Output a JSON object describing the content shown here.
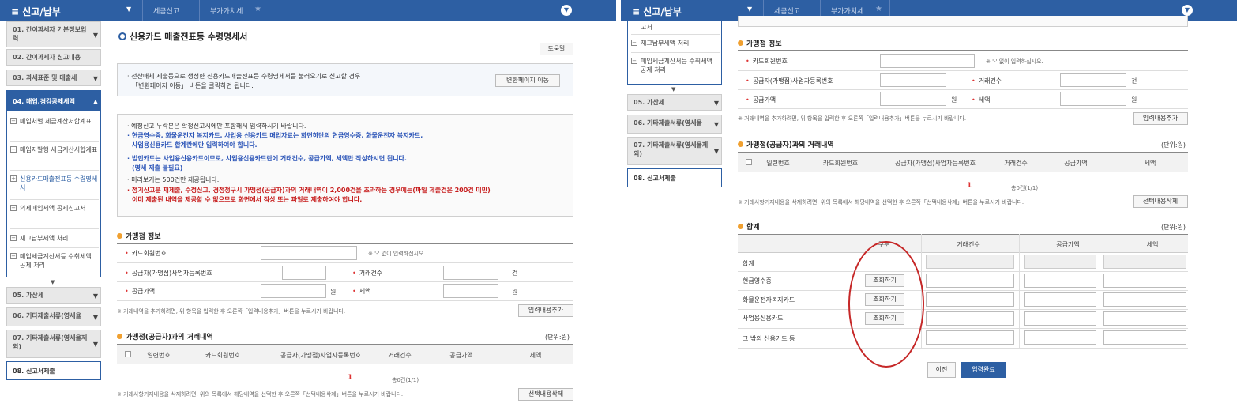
{
  "header": {
    "title": "신고/납부",
    "crumb1": "세금신고",
    "crumb2": "부가가치세"
  },
  "sidebar": {
    "steps": [
      {
        "label": "01. 간이과세자 기본정보입력"
      },
      {
        "label": "02. 간이과세자 신고내용"
      },
      {
        "label": "03. 과세표준 및 매출세"
      },
      {
        "label": "04. 매입,경감공제세액"
      },
      {
        "label": "05. 가산세"
      },
      {
        "label": "06. 기타제출서류(영세율"
      },
      {
        "label": "07. 기타제출서류(영세율제외)"
      },
      {
        "label": "08. 신고서제출"
      }
    ],
    "subitems": [
      {
        "label": "매입처별 세금계산서합계표"
      },
      {
        "label": "매입자발행 세금계산서합계표"
      },
      {
        "label": "신용카드매출전표등 수령명세서"
      },
      {
        "label": "의제매입세액 공제신고서"
      },
      {
        "label": "재고납부세액 처리"
      },
      {
        "label": "매입세금계산서등 수취세액 공제 처리"
      }
    ],
    "right_partial_tail": "고서"
  },
  "page": {
    "title": "신용카드 매출전표등 수령명세서",
    "help_button": "도움말",
    "convert_text_1": "전산매체 제출등으로 생성한 신용카드매출전표등 수령명세서를 불러오기로 신고할 경우",
    "convert_text_2": "「변환페이지 이동」 버튼을 클릭하면 됩니다.",
    "convert_button": "변환페이지 이동",
    "notices": [
      {
        "text": "예정신고 누락분은 확정신고시에만 포함해서 입력하시기 바랍니다.",
        "style": "normal"
      },
      {
        "text": "현금영수증, 화물운전자 복지카드, 사업용 신용카드 매입자료는 화면하단의 현금영수증, 화물운전자 복지카드,",
        "style": "blue"
      },
      {
        "text": "사업용신용카드 합계란에만 입력하여야 합니다.",
        "style": "blue"
      },
      {
        "text": "법인카드는 사업용신용카드이므로, 사업용신용카드란에 거래건수, 공급가액, 세액만 작성하시면 됩니다.",
        "style": "blue"
      },
      {
        "text": "(명세 제출 불필요)",
        "style": "blue"
      },
      {
        "text": "미리보기는 500건만 제공됩니다.",
        "style": "normal"
      },
      {
        "text": "정기신고분 재제출, 수정신고, 경정청구시 가맹점(공급자)과의 거래내역이 2,000건을 초과하는 경우에는(파일 제출건은 200건 미만)",
        "style": "red"
      },
      {
        "text": "이미 제출된 내역을 제공할 수 없으므로 화면에서 작성 또는 파일로 제출하여야 합니다.",
        "style": "red"
      }
    ]
  },
  "merchant": {
    "section_title": "가맹점 정보",
    "card_label": "카드회원번호",
    "card_note": "※ '-' 없이 입력하십시오.",
    "bizno_label": "공급자(가맹점)사업자등록번호",
    "count_label": "거래건수",
    "count_suffix": "건",
    "supply_label": "공급가액",
    "supply_suffix": "원",
    "tax_label": "세액",
    "tax_suffix": "원",
    "add_note": "※ 거래내역을 추가하려면, 위 항목을 입력한 후 오른쪽「입력내용추가」버튼을 누르시기 바랍니다.",
    "add_button": "입력내용추가"
  },
  "transactions": {
    "section_title": "가맹점(공급자)과의 거래내역",
    "unit": "(단위:원)",
    "columns": [
      "일련번호",
      "카드회원번호",
      "공급자(가맹점)사업자등록번호",
      "거래건수",
      "공급가액",
      "세액"
    ],
    "page": "1",
    "total": "총0건(1/1)",
    "delete_note": "※ 거래사항기재내용을 삭제하려면, 위의 목록에서 해당내역을 선택한 후 오른쪽「선택내용삭제」버튼을 누르시기 바랍니다.",
    "delete_button": "선택내용삭제"
  },
  "summary": {
    "section_title": "합계",
    "unit": "(단위:원)",
    "columns": [
      "구분",
      "거래건수",
      "공급가액",
      "세액"
    ],
    "rows": [
      {
        "label": "합계",
        "button": ""
      },
      {
        "label": "현금영수증",
        "button": "조회하기"
      },
      {
        "label": "화물운전자복지카드",
        "button": "조회하기"
      },
      {
        "label": "사업용신용카드",
        "button": "조회하기"
      },
      {
        "label": "그 밖의 신용카드 등",
        "button": ""
      }
    ]
  },
  "footer": {
    "prev_button": "이전",
    "complete_button": "입력완료"
  },
  "icons": {
    "menu": "menu-icon",
    "dropdown": "chevron-down-icon",
    "star": "star-icon",
    "header_toggle": "circle-chevron-icon"
  },
  "colors": {
    "header_bg": "#2d5fa3",
    "required": "#dd3333",
    "notice_blue": "#2c55b8",
    "notice_red": "#c61b1b",
    "highlight_circle": "#c62828"
  }
}
